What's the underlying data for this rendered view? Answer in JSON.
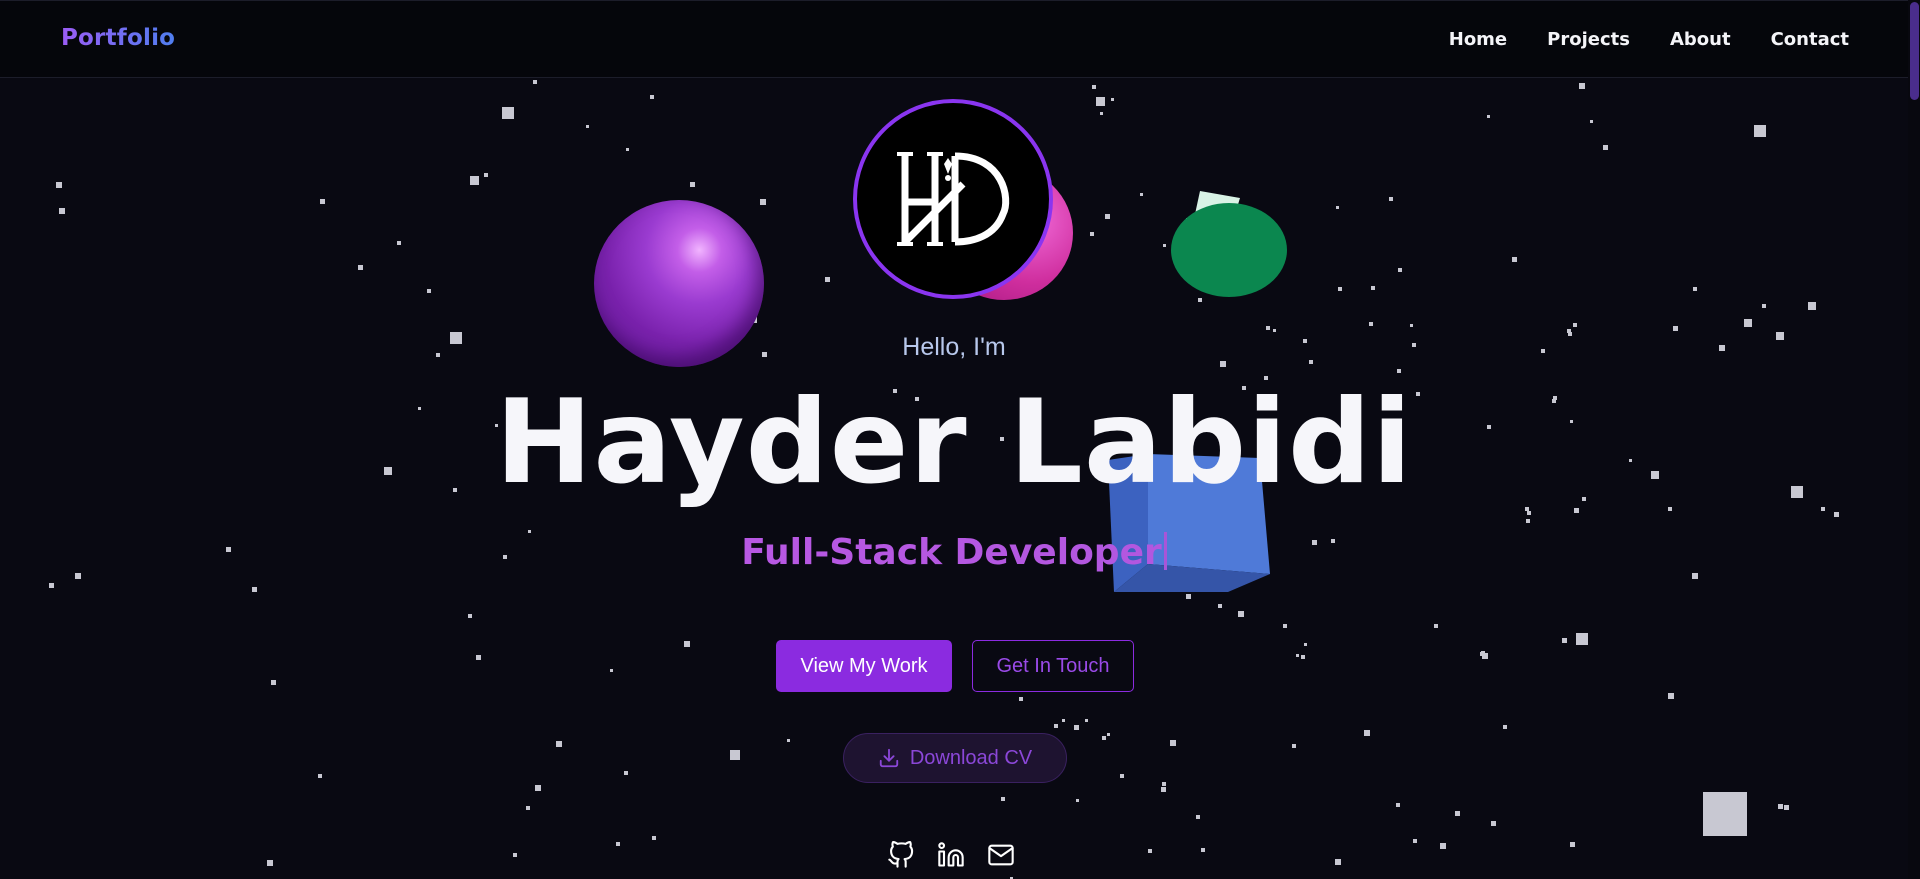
{
  "nav": {
    "brand": "Portfolio",
    "links": [
      "Home",
      "Projects",
      "About",
      "Contact"
    ]
  },
  "hero": {
    "greeting": "Hello, I'm",
    "name": "Hayder Labidi",
    "role": "Full-Stack Developer",
    "primary_button": "View My Work",
    "secondary_button": "Get In Touch",
    "cv_button": "Download CV",
    "logo_icon": "hd-monogram-logo"
  },
  "socials": [
    {
      "icon": "github-icon"
    },
    {
      "icon": "linkedin-icon"
    },
    {
      "icon": "mail-icon"
    }
  ],
  "colors": {
    "background": "#090912",
    "accent": "#8b2be0",
    "brand_gradient_start": "#9b5cf5",
    "brand_gradient_end": "#4f7ef0"
  }
}
